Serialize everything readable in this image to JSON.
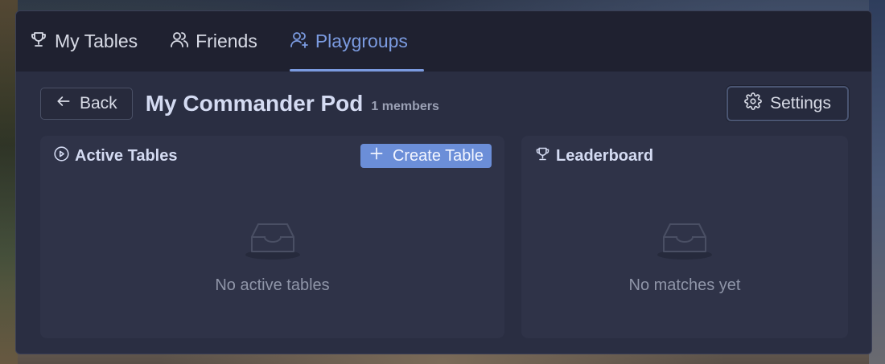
{
  "tabs": [
    {
      "label": "My Tables",
      "icon": "trophy-icon",
      "active": false
    },
    {
      "label": "Friends",
      "icon": "users-icon",
      "active": false
    },
    {
      "label": "Playgroups",
      "icon": "users-plus-icon",
      "active": true
    }
  ],
  "header": {
    "back_label": "Back",
    "title": "My Commander Pod",
    "members": "1 members",
    "settings_label": "Settings"
  },
  "active_tables": {
    "title": "Active Tables",
    "create_label": "Create Table",
    "empty_text": "No active tables"
  },
  "leaderboard": {
    "title": "Leaderboard",
    "empty_text": "No matches yet"
  },
  "colors": {
    "accent": "#7b9be0",
    "button": "#6b8ed8",
    "window_bg": "#2a2e42",
    "tabbar_bg": "#1f2130"
  }
}
